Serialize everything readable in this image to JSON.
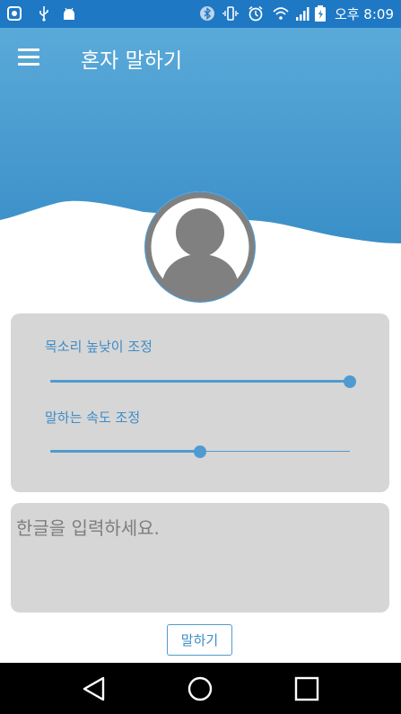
{
  "status_bar": {
    "time": "오후 8:09",
    "left_icons": [
      "notification-app-icon",
      "usb-icon",
      "android-debug-icon"
    ],
    "right_icons": [
      "bluetooth-icon",
      "vibrate-icon",
      "alarm-icon",
      "wifi-icon",
      "signal-icon",
      "battery-icon"
    ]
  },
  "app_bar": {
    "title": "혼자 말하기",
    "menu_icon": "hamburger-menu-icon"
  },
  "avatar": {
    "icon": "person-avatar-icon"
  },
  "sliders": [
    {
      "label": "목소리 높낮이 조정",
      "value": 1.0
    },
    {
      "label": "말하는 속도 조정",
      "value": 0.5
    }
  ],
  "input": {
    "placeholder": "한글을 입력하세요.",
    "value": ""
  },
  "speak_button": {
    "label": "말하기"
  },
  "nav_bar": {
    "icons": [
      "back-icon",
      "home-icon",
      "recents-icon"
    ]
  },
  "colors": {
    "status_bar": "#1e78c4",
    "header_gradient_top": "#5aaad9",
    "header_gradient_bottom": "#3a8fc8",
    "accent": "#4f9bd0",
    "panel": "#d6d6d6"
  }
}
